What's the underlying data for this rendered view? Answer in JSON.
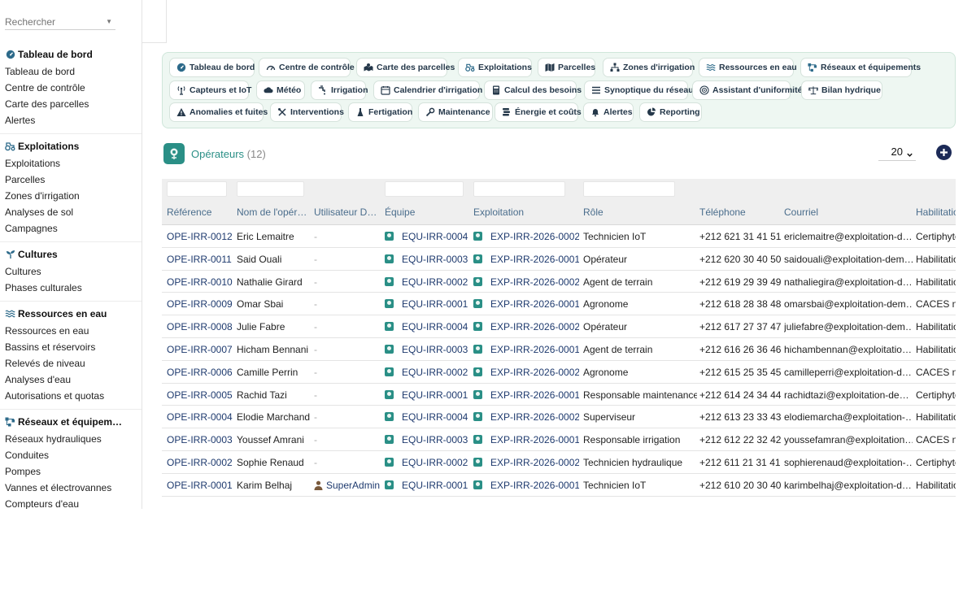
{
  "search": {
    "placeholder": "Rechercher"
  },
  "sidebar": {
    "sections": [
      {
        "title": "Tableau de bord",
        "icon": "dashboard-icon",
        "items": [
          "Tableau de bord",
          "Centre de contrôle",
          "Carte des parcelles",
          "Alertes"
        ]
      },
      {
        "title": "Exploitations",
        "icon": "tractor-icon",
        "items": [
          "Exploitations",
          "Parcelles",
          "Zones d'irrigation",
          "Analyses de sol",
          "Campagnes"
        ]
      },
      {
        "title": "Cultures",
        "icon": "sprout-icon",
        "items": [
          "Cultures",
          "Phases culturales"
        ]
      },
      {
        "title": "Ressources en eau",
        "icon": "water-icon",
        "items": [
          "Ressources en eau",
          "Bassins et réservoirs",
          "Relevés de niveau",
          "Analyses d'eau",
          "Autorisations et quotas"
        ]
      },
      {
        "title": "Réseaux et équipem…",
        "icon": "network-icon",
        "items": [
          "Réseaux hydrauliques",
          "Conduites",
          "Pompes",
          "Vannes et électrovannes",
          "Compteurs d'eau"
        ]
      }
    ]
  },
  "quicknav": {
    "rows": [
      [
        {
          "label": "Tableau de bord",
          "icon": "dashboard-icon"
        },
        {
          "label": "Centre de contrôle",
          "icon": "gauge-icon"
        },
        {
          "label": "Carte des parcelles",
          "icon": "map-pins-icon"
        },
        {
          "label": "Exploitations",
          "icon": "tractor-icon"
        },
        {
          "label": "Parcelles",
          "icon": "map-icon"
        },
        {
          "label": "Zones d'irrigation",
          "icon": "zones-icon"
        },
        {
          "label": "Ressources en eau",
          "icon": "water-icon"
        },
        {
          "label": "Réseaux et équipements",
          "icon": "network-icon"
        }
      ],
      [
        {
          "label": "Capteurs et IoT",
          "icon": "antenna-icon"
        },
        {
          "label": "Météo",
          "icon": "cloud-icon"
        },
        {
          "label": "Irrigation",
          "icon": "faucet-icon"
        },
        {
          "label": "Calendrier d'irrigation",
          "icon": "calendar-icon"
        },
        {
          "label": "Calcul des besoins",
          "icon": "calculator-icon"
        },
        {
          "label": "Synoptique du réseau",
          "icon": "list-icon"
        },
        {
          "label": "Assistant d'uniformité",
          "icon": "target-icon"
        },
        {
          "label": "Bilan hydrique",
          "icon": "scale-icon"
        }
      ],
      [
        {
          "label": "Anomalies et fuites",
          "icon": "warning-icon"
        },
        {
          "label": "Interventions",
          "icon": "tools-icon"
        },
        {
          "label": "Fertigation",
          "icon": "flask-icon"
        },
        {
          "label": "Maintenance",
          "icon": "wrench-icon"
        },
        {
          "label": "Énergie et coûts",
          "icon": "coins-icon"
        },
        {
          "label": "Alertes",
          "icon": "bell-icon"
        },
        {
          "label": "Reporting",
          "icon": "chart-pie-icon"
        }
      ]
    ]
  },
  "header": {
    "title": "Opérateurs",
    "count": "(12)",
    "page_size": "20"
  },
  "table": {
    "columns": [
      "Référence",
      "Nom de l'opér…",
      "Utilisateur D…",
      "Équipe",
      "Exploitation",
      "Rôle",
      "Téléphone",
      "Courriel",
      "Habilitatio"
    ],
    "rows": [
      {
        "ref": "OPE-IRR-0012",
        "name": "Eric Lemaitre",
        "user": "-",
        "team": "EQU-IRR-0004",
        "farm": "EXP-IRR-2026-0002",
        "role": "Technicien IoT",
        "phone": "+212 621 31 41 51",
        "email": "ericlemaitre@exploitation-d…",
        "hab": "Certiphyto"
      },
      {
        "ref": "OPE-IRR-0011",
        "name": "Said Ouali",
        "user": "-",
        "team": "EQU-IRR-0003",
        "farm": "EXP-IRR-2026-0001",
        "role": "Opérateur",
        "phone": "+212 620 30 40 50",
        "email": "saidouali@exploitation-dem…",
        "hab": "Habilitatio"
      },
      {
        "ref": "OPE-IRR-0010",
        "name": "Nathalie Girard",
        "user": "-",
        "team": "EQU-IRR-0002",
        "farm": "EXP-IRR-2026-0002",
        "role": "Agent de terrain",
        "phone": "+212 619 29 39 49",
        "email": "nathaliegira@exploitation-d…",
        "hab": "Habilitatio"
      },
      {
        "ref": "OPE-IRR-0009",
        "name": "Omar Sbai",
        "user": "-",
        "team": "EQU-IRR-0001",
        "farm": "EXP-IRR-2026-0001",
        "role": "Agronome",
        "phone": "+212 618 28 38 48",
        "email": "omarsbai@exploitation-dem…",
        "hab": "CACES na"
      },
      {
        "ref": "OPE-IRR-0008",
        "name": "Julie Fabre",
        "user": "-",
        "team": "EQU-IRR-0004",
        "farm": "EXP-IRR-2026-0002",
        "role": "Opérateur",
        "phone": "+212 617 27 37 47",
        "email": "juliefabre@exploitation-dem…",
        "hab": "Habilitatio"
      },
      {
        "ref": "OPE-IRR-0007",
        "name": "Hicham Bennani",
        "user": "-",
        "team": "EQU-IRR-0003",
        "farm": "EXP-IRR-2026-0001",
        "role": "Agent de terrain",
        "phone": "+212 616 26 36 46",
        "email": "hichambennan@exploitatio…",
        "hab": "Habilitatio"
      },
      {
        "ref": "OPE-IRR-0006",
        "name": "Camille Perrin",
        "user": "-",
        "team": "EQU-IRR-0002",
        "farm": "EXP-IRR-2026-0002",
        "role": "Agronome",
        "phone": "+212 615 25 35 45",
        "email": "camilleperri@exploitation-d…",
        "hab": "CACES na"
      },
      {
        "ref": "OPE-IRR-0005",
        "name": "Rachid Tazi",
        "user": "-",
        "team": "EQU-IRR-0001",
        "farm": "EXP-IRR-2026-0001",
        "role": "Responsable maintenance",
        "phone": "+212 614 24 34 44",
        "email": "rachidtazi@exploitation-de…",
        "hab": "Certiphyto"
      },
      {
        "ref": "OPE-IRR-0004",
        "name": "Elodie Marchand",
        "user": "-",
        "team": "EQU-IRR-0004",
        "farm": "EXP-IRR-2026-0002",
        "role": "Superviseur",
        "phone": "+212 613 23 33 43",
        "email": "elodiemarcha@exploitation-…",
        "hab": "Habilitatio"
      },
      {
        "ref": "OPE-IRR-0003",
        "name": "Youssef Amrani",
        "user": "-",
        "team": "EQU-IRR-0003",
        "farm": "EXP-IRR-2026-0001",
        "role": "Responsable irrigation",
        "phone": "+212 612 22 32 42",
        "email": "youssefamran@exploitation…",
        "hab": "CACES na"
      },
      {
        "ref": "OPE-IRR-0002",
        "name": "Sophie Renaud",
        "user": "-",
        "team": "EQU-IRR-0002",
        "farm": "EXP-IRR-2026-0002",
        "role": "Technicien hydraulique",
        "phone": "+212 611 21 31 41",
        "email": "sophierenaud@exploitation-…",
        "hab": "Certiphyto"
      },
      {
        "ref": "OPE-IRR-0001",
        "name": "Karim Belhaj",
        "user": "SuperAdmin",
        "team": "EQU-IRR-0001",
        "farm": "EXP-IRR-2026-0001",
        "role": "Technicien IoT",
        "phone": "+212 610 20 30 40",
        "email": "karimbelhaj@exploitation-d…",
        "hab": "Habilitatio"
      }
    ]
  },
  "colors": {
    "accent": "#2a8f86",
    "link": "#1e3a6e",
    "panel_bg": "#eef7f2",
    "add_button": "#1c2a57"
  }
}
